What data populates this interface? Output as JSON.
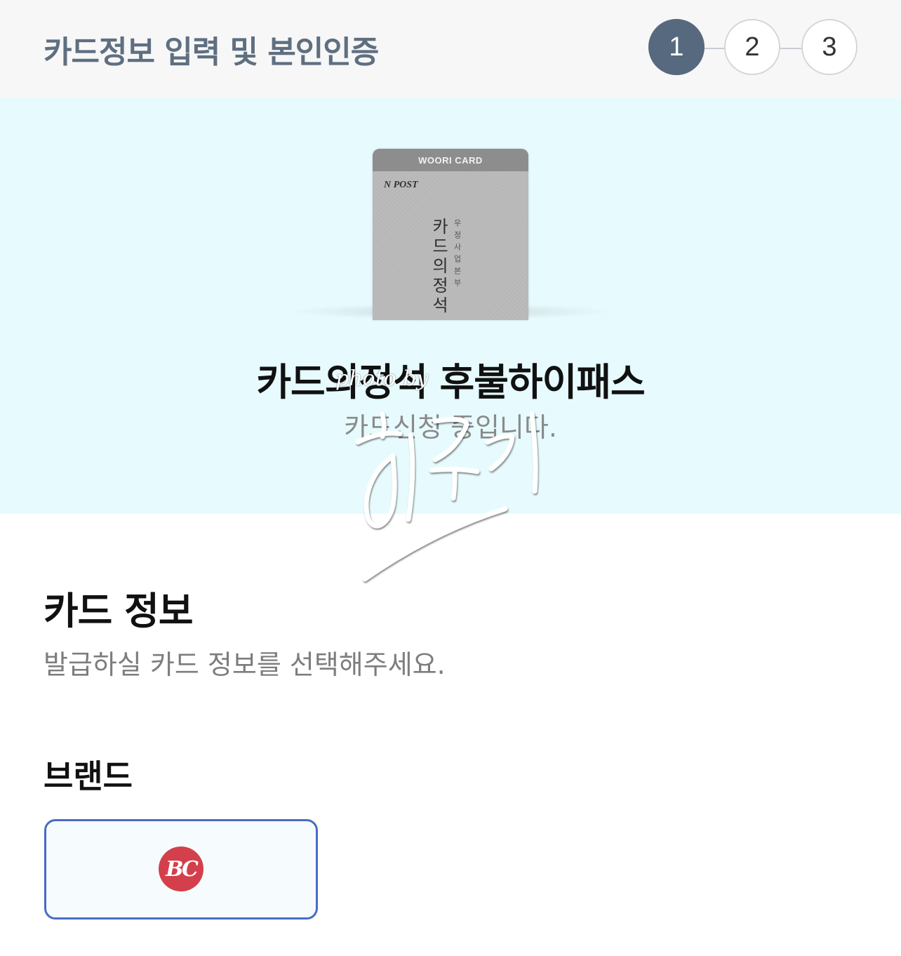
{
  "header": {
    "title": "카드정보 입력 및 본인인증",
    "steps": [
      "1",
      "2",
      "3"
    ],
    "active_step": 1
  },
  "hero": {
    "card_image": {
      "top_label": "WOORI CARD",
      "logo": "N POST",
      "vertical_title": "카드의정석",
      "vertical_subtitle": "우정사업본부"
    },
    "card_name": "카드의정석 후불하이패스",
    "status": "카드신청 중입니다.",
    "watermark_text": "photo by",
    "watermark_signature": "히드리"
  },
  "card_info": {
    "title": "카드 정보",
    "description": "발급하실 카드 정보를 선택해주세요."
  },
  "brand": {
    "label": "브랜드",
    "options": [
      {
        "logo": "BC",
        "selected": true
      }
    ]
  },
  "colors": {
    "header_bg": "#f7f7f8",
    "hero_bg": "#e7fbfe",
    "active_step": "#56697f",
    "selected_border": "#4a6bc4",
    "bc_red": "#d3404b"
  }
}
